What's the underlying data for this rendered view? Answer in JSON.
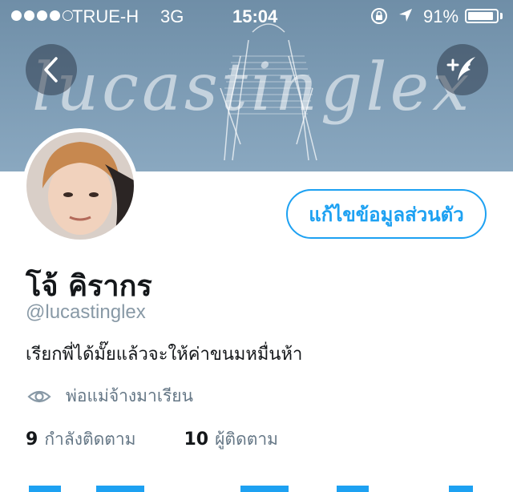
{
  "status_bar": {
    "carrier": "TRUE-H",
    "network": "3G",
    "time": "15:04",
    "battery": "91%",
    "battery_level": 0.91,
    "signal_bars": 4,
    "signal_total": 5,
    "icons": [
      "rotation-lock-icon",
      "location-arrow-icon",
      "battery-icon"
    ]
  },
  "header": {
    "banner_text": "lucastinglex",
    "background_color": "#7b9ab3",
    "back_icon": "chevron-left-icon",
    "compose_icon": "compose-tweet-icon"
  },
  "profile": {
    "edit_button": "แก้ไขข้อมูลส่วนตัว",
    "name": "โจ้ คิรากร",
    "handle": "@lucastinglex",
    "bio": "เรียกพี่ได้มั๊ยแล้วจะให้ค่าขนมหมื่นห้า",
    "location_icon": "eye-icon",
    "location": "พ่อแม่จ้างมาเรียน",
    "following_count": "9",
    "following_label": "กำลังติดตาม",
    "followers_count": "10",
    "followers_label": "ผู้ติดตาม"
  },
  "colors": {
    "accent": "#1da1f2",
    "primary_text": "#14171a",
    "secondary_text": "#657786",
    "handle_text": "#8899a6"
  }
}
